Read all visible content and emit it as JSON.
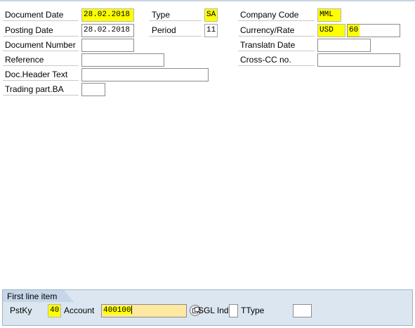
{
  "header": {
    "document_date": {
      "label": "Document Date",
      "value": "28.02.2018"
    },
    "posting_date": {
      "label": "Posting Date",
      "value": "28.02.2018"
    },
    "document_number": {
      "label": "Document Number",
      "value": ""
    },
    "reference": {
      "label": "Reference",
      "value": ""
    },
    "doc_header_text": {
      "label": "Doc.Header Text",
      "value": ""
    },
    "trading_part_ba": {
      "label": "Trading part.BA",
      "value": ""
    },
    "type": {
      "label": "Type",
      "value": "SA"
    },
    "period": {
      "label": "Period",
      "value": "11"
    },
    "company_code": {
      "label": "Company Code",
      "value": "MML"
    },
    "currency_rate": {
      "label": "Currency/Rate",
      "currency": "USD",
      "rate": "60"
    },
    "translatn_date": {
      "label": "Translatn Date",
      "value": ""
    },
    "cross_cc_no": {
      "label": "Cross-CC no.",
      "value": ""
    }
  },
  "first_line_item": {
    "title": "First line item",
    "pstky": {
      "label": "PstKy",
      "value": "40"
    },
    "account": {
      "label": "Account",
      "value": "400100"
    },
    "sgl_ind": {
      "label": "SGL Ind",
      "value": ""
    },
    "ttype": {
      "label": "TType",
      "value": ""
    }
  },
  "colors": {
    "required_highlight": "#ffff00",
    "panel_bg": "#dce6f0"
  },
  "icons": [
    "matchcode-icon"
  ]
}
